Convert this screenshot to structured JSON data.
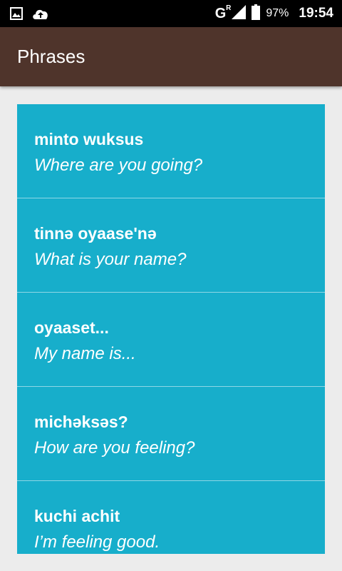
{
  "status_bar": {
    "network_label": "G",
    "network_sup": "R",
    "battery_percent": "97%",
    "time": "19:54",
    "icons": [
      "image-icon",
      "cloud-upload-icon",
      "signal-icon",
      "battery-icon"
    ]
  },
  "app_bar": {
    "title": "Phrases",
    "color": "#4f342b"
  },
  "list": {
    "background_color": "#17aecb",
    "items": [
      {
        "native": "minto wuksus",
        "english": "Where are you going?"
      },
      {
        "native": "tinnə oyaase'nə",
        "english": "What is your name?"
      },
      {
        "native": "oyaaset...",
        "english": "My name is..."
      },
      {
        "native": "michəksəs?",
        "english": "How are you feeling?"
      },
      {
        "native": "kuchi achit",
        "english": "I’m feeling good."
      }
    ]
  }
}
